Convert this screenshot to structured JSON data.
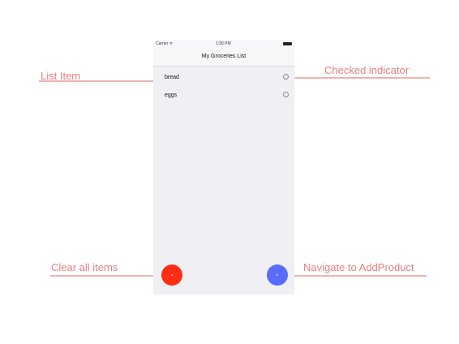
{
  "status_bar": {
    "carrier": "Carrier ᯤ",
    "time": "1:30 PM"
  },
  "app": {
    "title": "My Groceries List"
  },
  "list": {
    "items": [
      {
        "label": "bread",
        "checked": false
      },
      {
        "label": "eggs",
        "checked": false
      }
    ]
  },
  "buttons": {
    "clear_color": "#ff2d12",
    "add_color": "#5a6cff"
  },
  "annotations": {
    "list_item": "List Item",
    "checked_indicator": "Checked indicator",
    "clear_all": "Clear all items",
    "navigate": "Navigate to AddProduct",
    "line_color": "#edb3b3"
  }
}
